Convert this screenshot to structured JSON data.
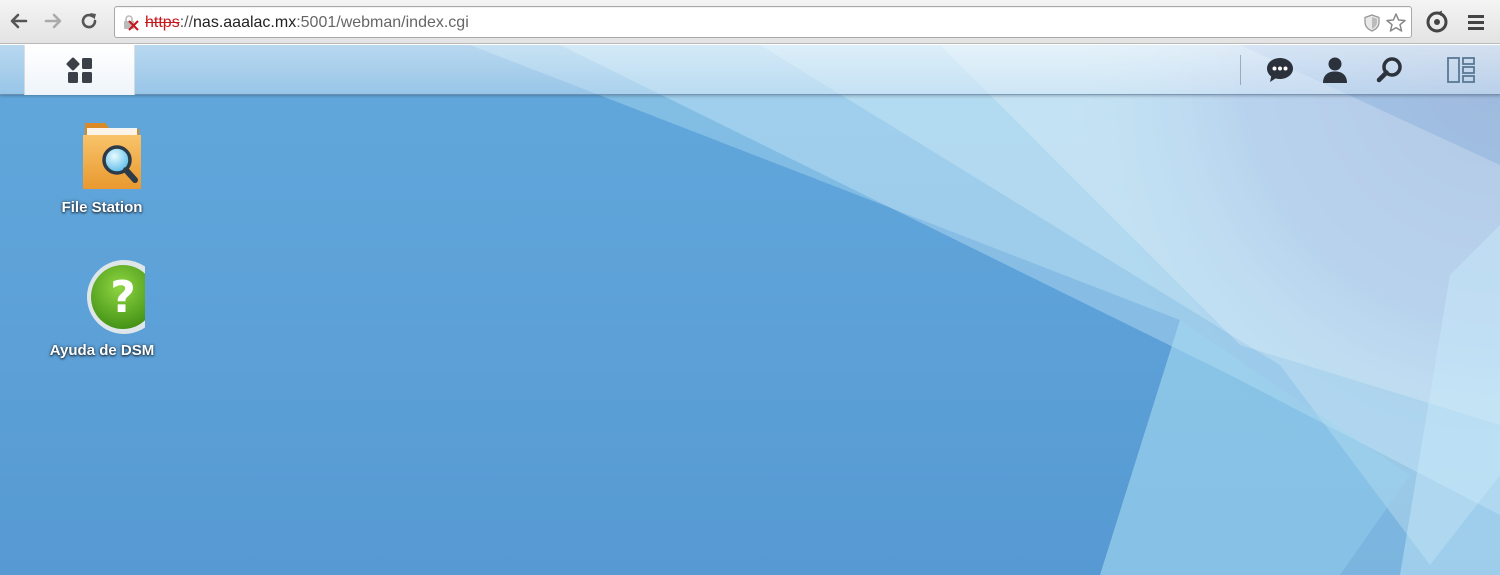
{
  "browser": {
    "url_scheme": "https",
    "url_separator": "://",
    "url_host": "nas.aaalac.mx",
    "url_path": ":5001/webman/index.cgi"
  },
  "taskbar": {
    "main_menu_icon": "apps-grid-icon",
    "right_icons": [
      "chat-icon",
      "user-icon",
      "search-icon",
      "widgets-icon"
    ]
  },
  "desktop": {
    "icons": [
      {
        "label": "File Station",
        "icon": "folder-search-icon"
      },
      {
        "label": "Ayuda de DSM",
        "icon": "help-icon"
      }
    ]
  },
  "colors": {
    "wallpaper_base": "#5aa0d8",
    "wallpaper_dark": "#2a4fb0",
    "help_green": "#5caa1f",
    "folder_orange": "#f2a640",
    "insecure_red": "#c8161d"
  }
}
